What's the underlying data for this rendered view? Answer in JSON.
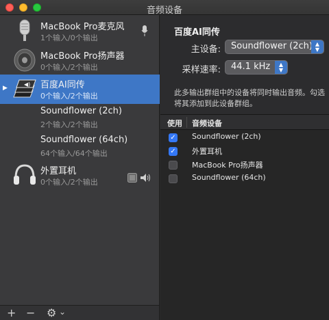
{
  "window": {
    "title": "音频设备"
  },
  "sidebar": {
    "devices": [
      {
        "name": "MacBook Pro麦克风",
        "io": "1个输入/0个输出",
        "icon": "microphone-icon",
        "right_icon": "mic-small-icon"
      },
      {
        "name": "MacBook Pro扬声器",
        "io": "0个输入/2个输出",
        "icon": "speaker-icon"
      },
      {
        "name": "百度AI同传",
        "io": "0个输入/2个输出",
        "icon": "aggregate-device-icon",
        "selected": true,
        "disclosure": "▶"
      },
      {
        "name": "Soundflower (2ch)",
        "io": "2个输入/2个输出"
      },
      {
        "name": "Soundflower (64ch)",
        "io": "64个输入/64个输出"
      },
      {
        "name": "外置耳机",
        "io": "0个输入/2个输出",
        "icon": "headphones-icon",
        "right_icons": [
          "finder-icon",
          "volume-icon"
        ]
      }
    ],
    "bottom": {
      "add": "+",
      "remove": "−",
      "gear": "⚙︎",
      "gear_menu": "⌄"
    }
  },
  "detail": {
    "title": "百度AI同传",
    "master_label": "主设备:",
    "master_value": "Soundflower (2ch)",
    "rate_label": "采样速率:",
    "rate_value": "44.1 kHz",
    "description_line1": "此多输出群组中的设备将同时输出音频。勾选",
    "description_line2": "将其添加到此设备群组。",
    "table": {
      "col_use": "使用",
      "col_device": "音频设备",
      "rows": [
        {
          "checked": true,
          "name": "Soundflower (2ch)"
        },
        {
          "checked": true,
          "name": "外置耳机"
        },
        {
          "checked": false,
          "name": "MacBook Pro扬声器"
        },
        {
          "checked": false,
          "name": "Soundflower (64ch)"
        }
      ]
    }
  },
  "colors": {
    "accent": "#3e77c6",
    "checkbox": "#3478f6"
  }
}
